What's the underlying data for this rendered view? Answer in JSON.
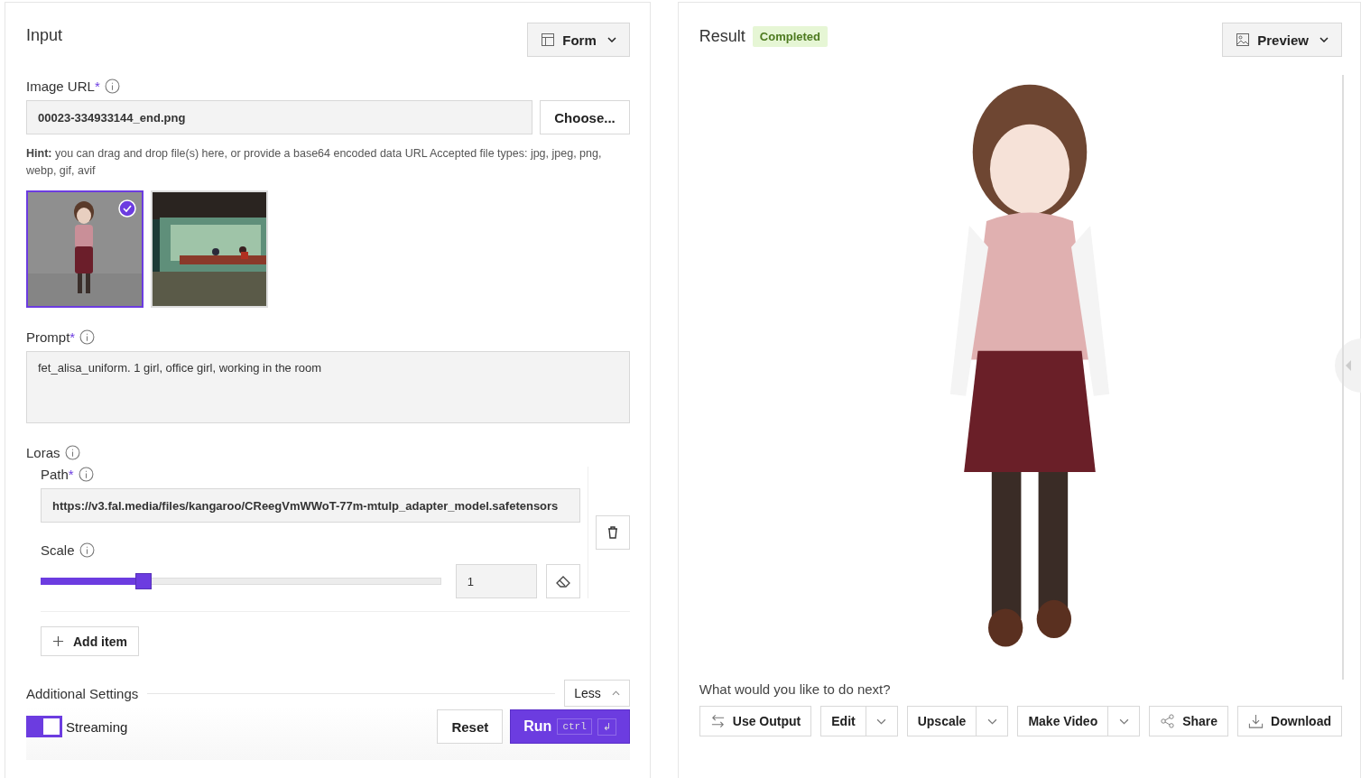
{
  "input": {
    "title": "Input",
    "view_button": "Form",
    "image_url": {
      "label": "Image URL",
      "required": "*",
      "value": "00023-334933144_end.png",
      "choose": "Choose...",
      "hint_bold": "Hint:",
      "hint": "you can drag and drop file(s) here, or provide a base64 encoded data URL Accepted file types: jpg, jpeg, png, webp, gif, avif",
      "thumbnails": [
        {
          "kind": "picture",
          "selected": true
        },
        {
          "kind": "picture",
          "selected": false
        }
      ]
    },
    "prompt": {
      "label": "Prompt",
      "required": "*",
      "value": "fet_alisa_uniform. 1 girl, office girl, working in the room"
    },
    "loras": {
      "label": "Loras",
      "items": [
        {
          "path_label": "Path",
          "required": "*",
          "path": "https://v3.fal.media/files/kangaroo/CReegVmWWoT-77m-mtulp_adapter_model.safetensors",
          "scale_label": "Scale",
          "level": 0.26,
          "scale": "1"
        }
      ],
      "add_item": "Add item"
    },
    "additional": {
      "label": "Additional Settings",
      "toggle": "Less"
    },
    "streaming": {
      "label": "Streaming",
      "on": true
    },
    "reset": "Reset",
    "run": "Run",
    "keys": [
      "ctrl",
      "↲"
    ]
  },
  "result": {
    "title": "Result",
    "status": "Completed",
    "view_button": "Preview",
    "image": {
      "kind": "picture"
    },
    "next_prompt": "What would you like to do next?",
    "actions": [
      {
        "label": "Use Output",
        "kind": "swap"
      },
      {
        "label": "Edit",
        "kind": "split"
      },
      {
        "label": "Upscale",
        "kind": "split"
      },
      {
        "label": "Make Video",
        "kind": "split"
      },
      {
        "label": "Share",
        "kind": "share"
      },
      {
        "label": "Download",
        "kind": "download"
      }
    ]
  }
}
